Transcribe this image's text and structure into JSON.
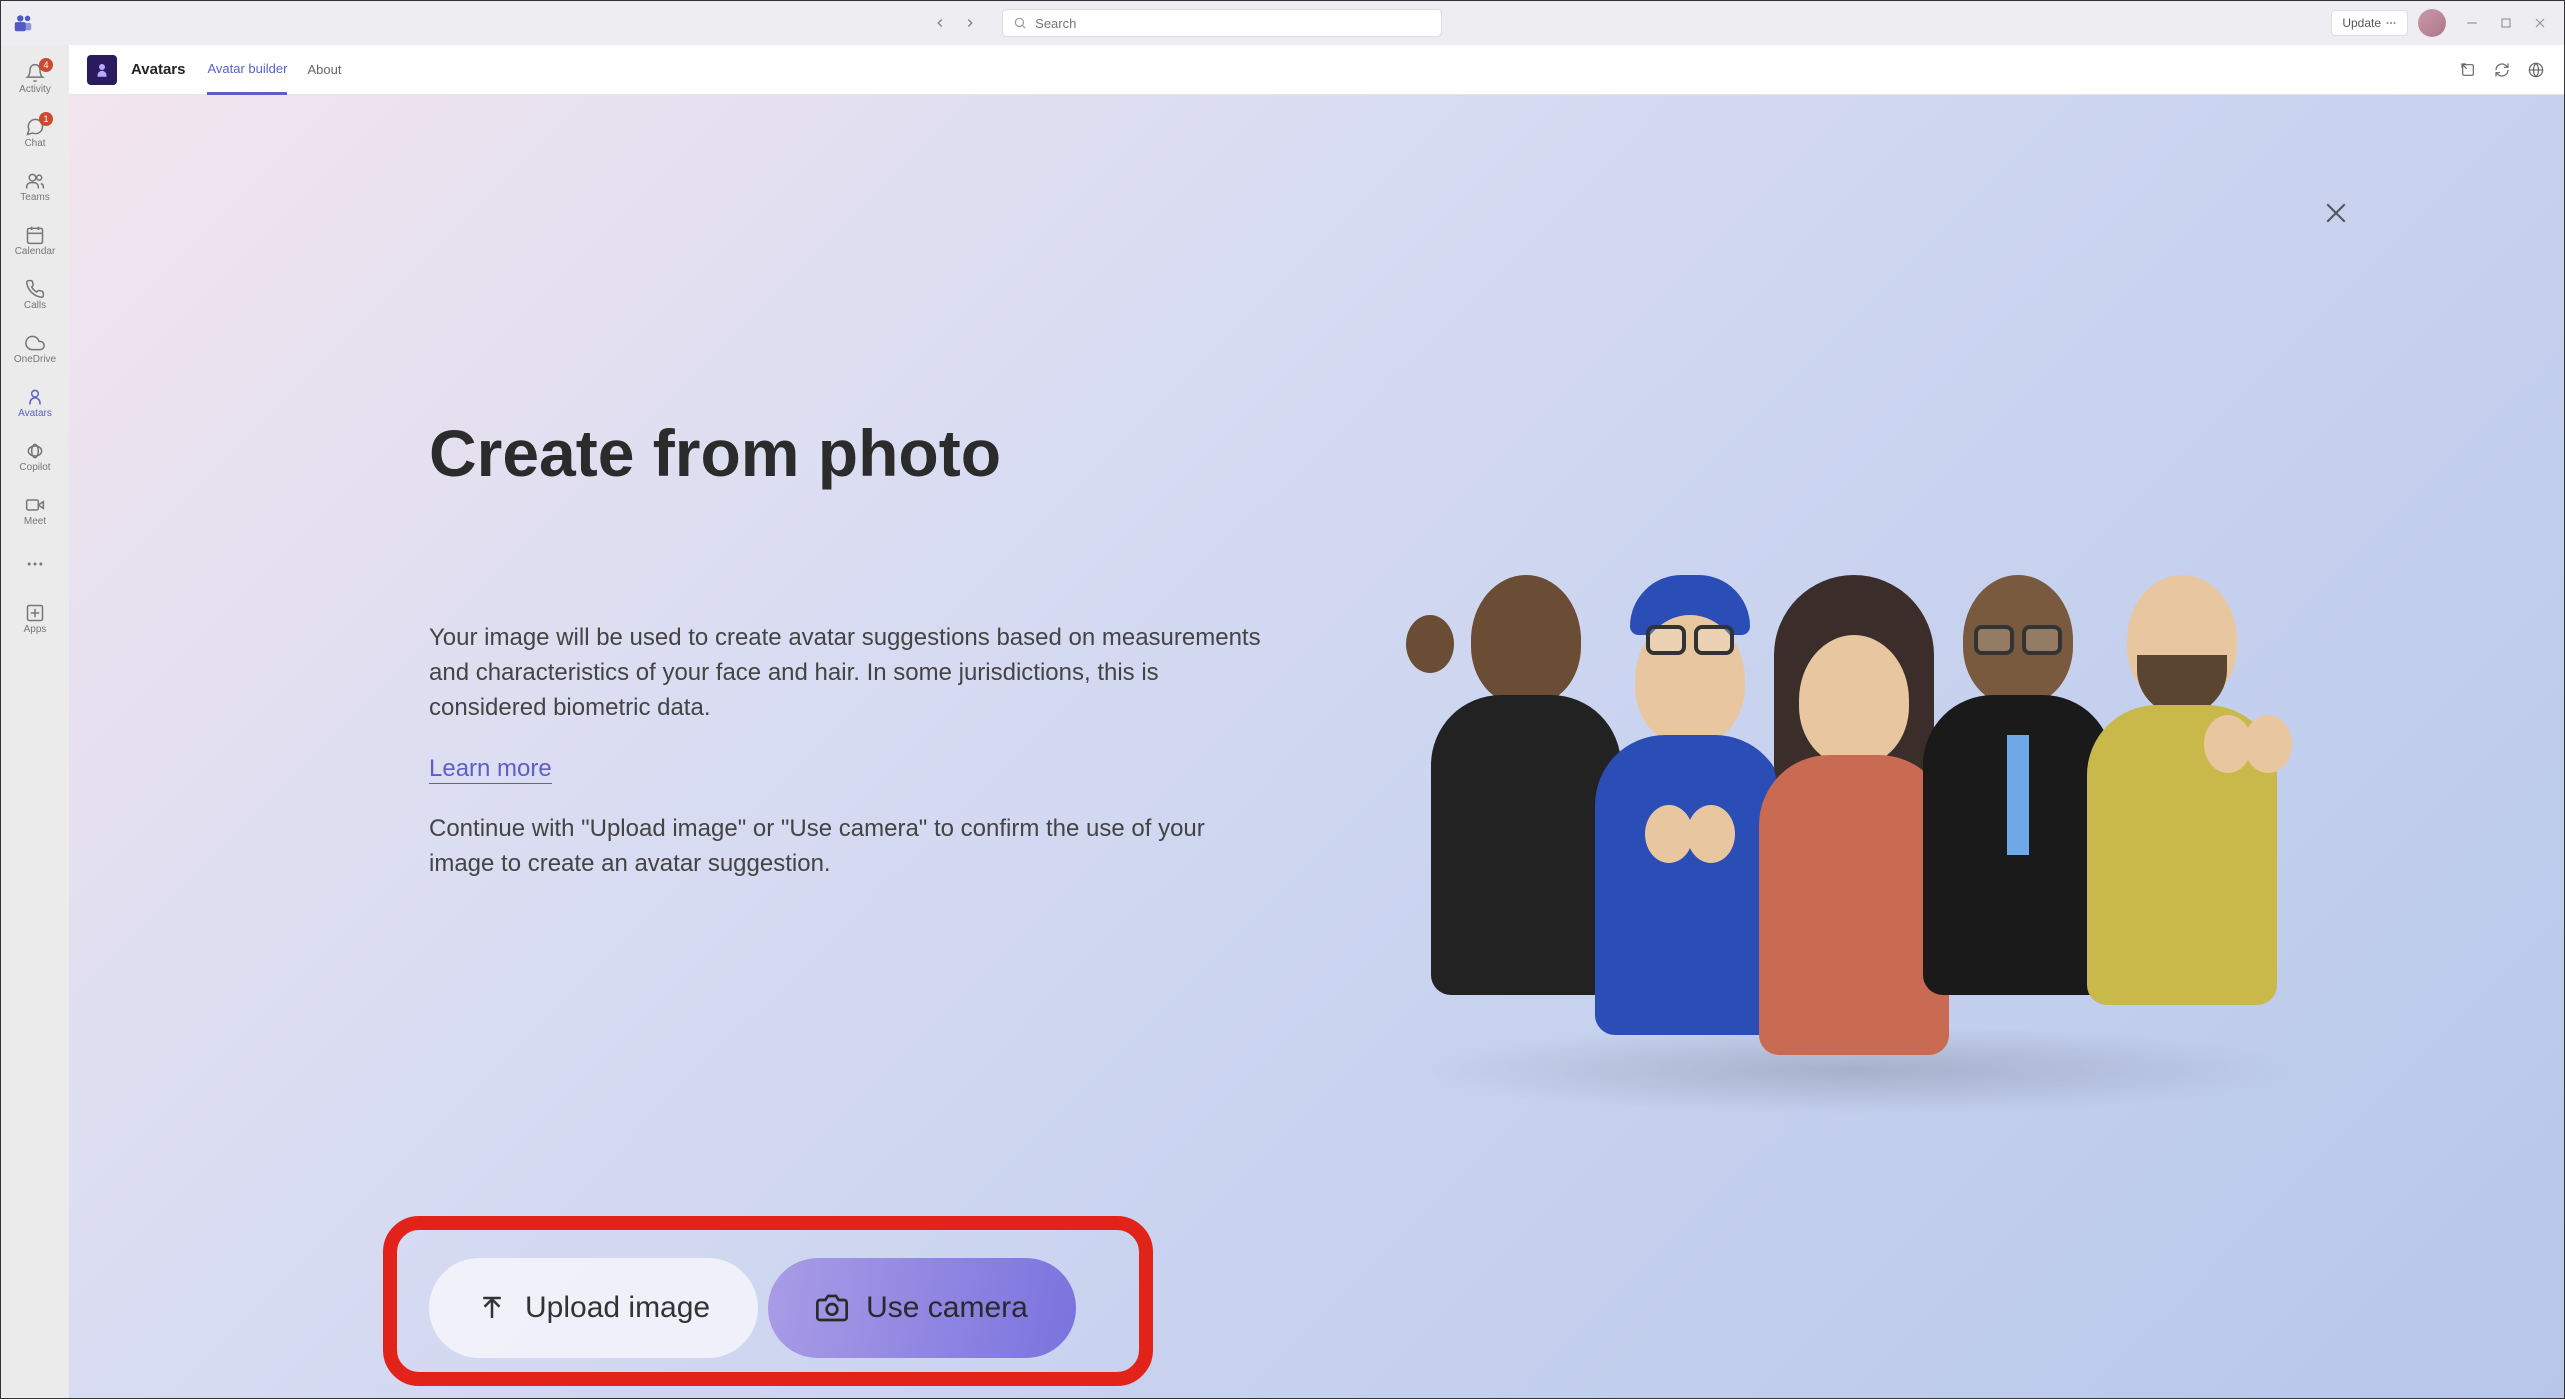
{
  "titlebar": {
    "search_placeholder": "Search",
    "update_label": "Update"
  },
  "rail": {
    "items": [
      {
        "label": "Activity",
        "badge": "4"
      },
      {
        "label": "Chat",
        "badge": "1"
      },
      {
        "label": "Teams",
        "badge": ""
      },
      {
        "label": "Calendar",
        "badge": ""
      },
      {
        "label": "Calls",
        "badge": ""
      },
      {
        "label": "OneDrive",
        "badge": ""
      },
      {
        "label": "Avatars",
        "badge": ""
      },
      {
        "label": "Copilot",
        "badge": ""
      },
      {
        "label": "Meet",
        "badge": ""
      }
    ],
    "more_label": "",
    "apps_label": "Apps"
  },
  "app_header": {
    "title": "Avatars",
    "tabs": [
      {
        "label": "Avatar builder",
        "active": true
      },
      {
        "label": "About",
        "active": false
      }
    ]
  },
  "main": {
    "heading": "Create from photo",
    "body": "Your image will be used to create avatar suggestions based on measurements and characteristics of your face and hair. In some jurisdictions, this is considered biometric data.",
    "learn_more": "Learn more",
    "confirm": "Continue with \"Upload image\" or \"Use camera\" to confirm the use of your image to create an avatar suggestion.",
    "upload_label": "Upload image",
    "camera_label": "Use camera"
  },
  "colors": {
    "accent": "#5b5fc7",
    "highlight": "#e2231a"
  }
}
